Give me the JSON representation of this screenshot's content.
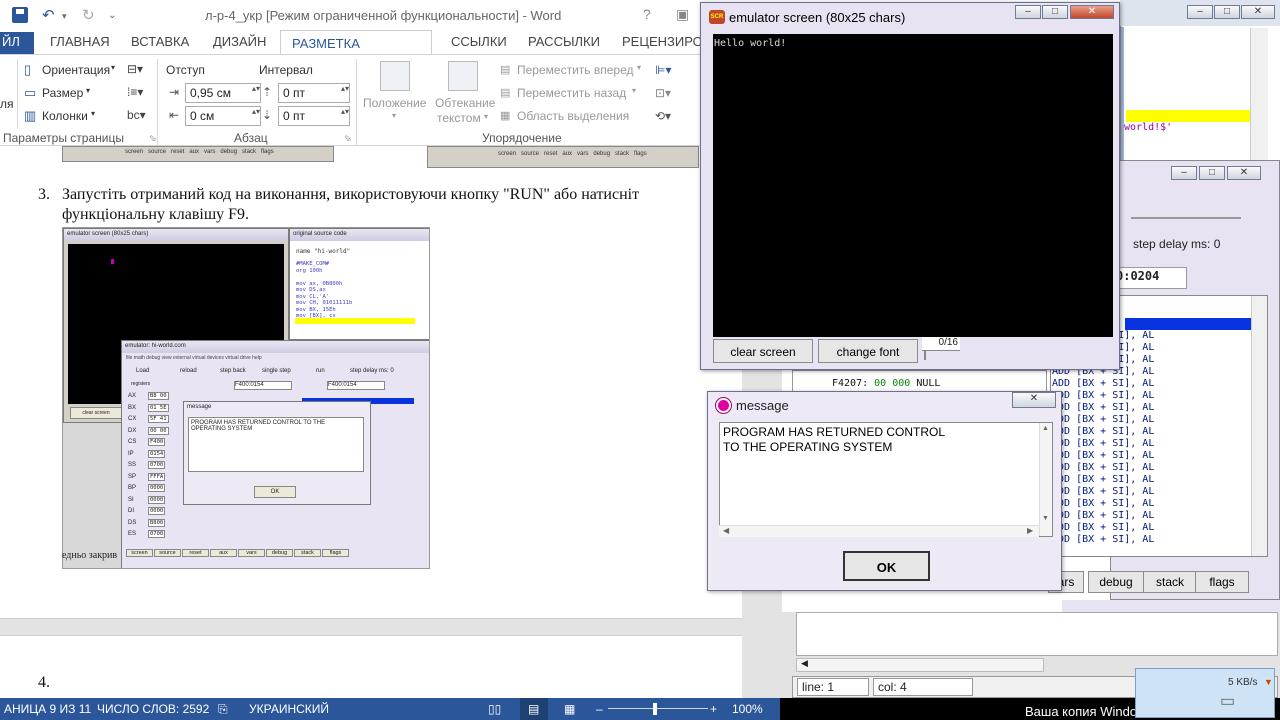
{
  "word": {
    "title": "л-р-4_укр [Режим ограниченной функциональности] - Word",
    "help": "?",
    "tabs": {
      "file": "ЙЛ",
      "home": "ГЛАВНАЯ",
      "insert": "ВСТАВКА",
      "design": "ДИЗАЙН",
      "layout": "РАЗМЕТКА СТРАНИЦЫ",
      "references": "ССЫЛКИ",
      "mailings": "РАССЫЛКИ",
      "review": "РЕЦЕНЗИРОВА"
    },
    "ribbon": {
      "orientation": "Ориентация",
      "size": "Размер",
      "columns": "Колонки",
      "page_setup_group": "Параметры страницы",
      "indent_label": "Отступ",
      "indent_left": "0,95 см",
      "indent_right": "0 см",
      "spacing_label": "Интервал",
      "spacing_before": "0 пт",
      "spacing_after": "0 пт",
      "paragraph_group": "Абзац",
      "position": "Положение",
      "wrap_line1": "Обтекание",
      "wrap_line2": "текстом",
      "bring_forward": "Переместить вперед",
      "send_backward": "Переместить назад",
      "selection_pane": "Область выделения",
      "arrange_group": "Упорядочение",
      "cut_left": "ля"
    },
    "doc": {
      "step_number": "3.",
      "step_line1": "Запустіть отриманий код на виконання, використовуючи кнопку \"RUN\" або натисніт",
      "step_line2": "функціональну клавішу F9.",
      "after_image": "едньо закрив",
      "step4_number": "4."
    },
    "status": {
      "page": "АНИЦА 9 ИЗ 11",
      "words": "ЧИСЛО СЛОВ: 2592",
      "language": "УКРАИНСКИЙ",
      "zoom": "100%"
    }
  },
  "embedded_shot": {
    "emu_title": "emulator screen (80x25 chars)",
    "src_title": "original source code",
    "src_name": "name \"hi-world\"",
    "src_lines": [
      "#MAKE_COM#",
      "org 100h",
      "",
      "mov ax, 0B800h",
      "mov DS,ax",
      "mov CL,'A'",
      "mov CH, 01011111b",
      "mov BX, 15Eh",
      "mov [BX], cx",
      "ret"
    ],
    "emulator_title": "emulator: hi-world.com",
    "menu": "file   math   debug   view   external   virtual devices   virtual drive   help",
    "tool_load": "Load",
    "tool_reload": "reload",
    "tool_stepback": "step back",
    "tool_single": "single step",
    "tool_run": "run",
    "step_delay": "step delay ms: 0",
    "clear_screen": "clear screen",
    "addr1": "F400:0154",
    "addr2": "F400:0154",
    "registers": "registers",
    "reg_names": [
      "AX",
      "BX",
      "CX",
      "DX",
      "CS",
      "IP",
      "SS",
      "SP",
      "BP",
      "SI",
      "DI",
      "DS",
      "ES"
    ],
    "reg_vals": [
      "B8 00",
      "01 5E",
      "5F 41",
      "00 00",
      "F400",
      "0154",
      "0700",
      "FFFA",
      "0000",
      "0000",
      "0000",
      "B800",
      "0700"
    ],
    "msg_title": "message",
    "msg_text": "PROGRAM HAS RETURNED CONTROL TO THE OPERATING SYSTEM",
    "ok": "OK",
    "bottom_tabs": [
      "screen",
      "source",
      "reset",
      "aux",
      "vars",
      "debug",
      "stack",
      "flags"
    ]
  },
  "editor": {
    "code_fragment": "world!$'"
  },
  "emulator": {
    "step_delay": "step delay ms: 0",
    "address": "0:0204",
    "rows_left": [
      {
        "addr": "F4207:",
        "b1": "00",
        "b2": "000",
        "op": "NULL"
      }
    ],
    "rows_right": [
      "ADD [BX + SI], AL",
      "ADD [BX + SI], AL",
      "ADD [BX + SI], AL",
      "ADD [BX + SI], AL",
      "ADD [BX + SI], AL",
      "ADD [BX + SI], AL",
      "ADD [BX + SI], AL",
      "ADD [BX + SI], AL",
      "ADD [BX + SI], AL",
      "ADD [BX + SI], AL",
      "ADD [BX + SI], AL",
      "ADD [BX + SI], AL",
      "ADD [BX + SI], AL",
      "ADD [BX + SI], AL",
      "ADD [BX + SI], AL",
      "ADD [BX + SI], AL",
      "ADD [BX + SI], AL",
      "ADD [BX + SI], AL"
    ],
    "tab_vars_cut": "ars",
    "tab_debug": "debug",
    "tab_stack": "stack",
    "tab_flags": "flags",
    "line": "line: 1",
    "col": "col: 4"
  },
  "emu_screen": {
    "title": "emulator screen (80x25 chars)",
    "output": "Hello world!",
    "clear": "clear screen",
    "change_font": "change font",
    "counter": "0/16"
  },
  "message": {
    "title": "message",
    "line1": "PROGRAM HAS RETURNED CONTROL",
    "line2": "TO THE OPERATING SYSTEM",
    "ok": "OK"
  },
  "tray": {
    "speed": "5 KB/s"
  },
  "watermark": "Ваша копия Windows"
}
